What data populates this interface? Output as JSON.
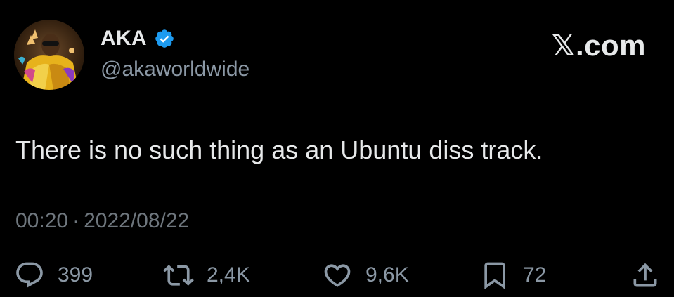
{
  "author": {
    "display_name": "AKA",
    "handle": "@akaworldwide",
    "verified": true,
    "verified_color": "#1d9bf0"
  },
  "brand": "𝕏.com",
  "tweet": {
    "text": "There is no such thing as an Ubuntu diss track."
  },
  "meta": {
    "time": "00:20",
    "separator": "·",
    "date": "2022/08/22"
  },
  "actions": {
    "reply": {
      "icon": "reply-icon",
      "count": "399"
    },
    "retweet": {
      "icon": "retweet-icon",
      "count": "2,4K"
    },
    "like": {
      "icon": "heart-icon",
      "count": "9,6K"
    },
    "bookmark": {
      "icon": "bookmark-icon",
      "count": "72"
    },
    "share": {
      "icon": "share-icon"
    }
  },
  "colors": {
    "background": "#000000",
    "text_primary": "#e7e9ea",
    "text_secondary": "#8b98a5",
    "text_muted": "#6e767d"
  }
}
